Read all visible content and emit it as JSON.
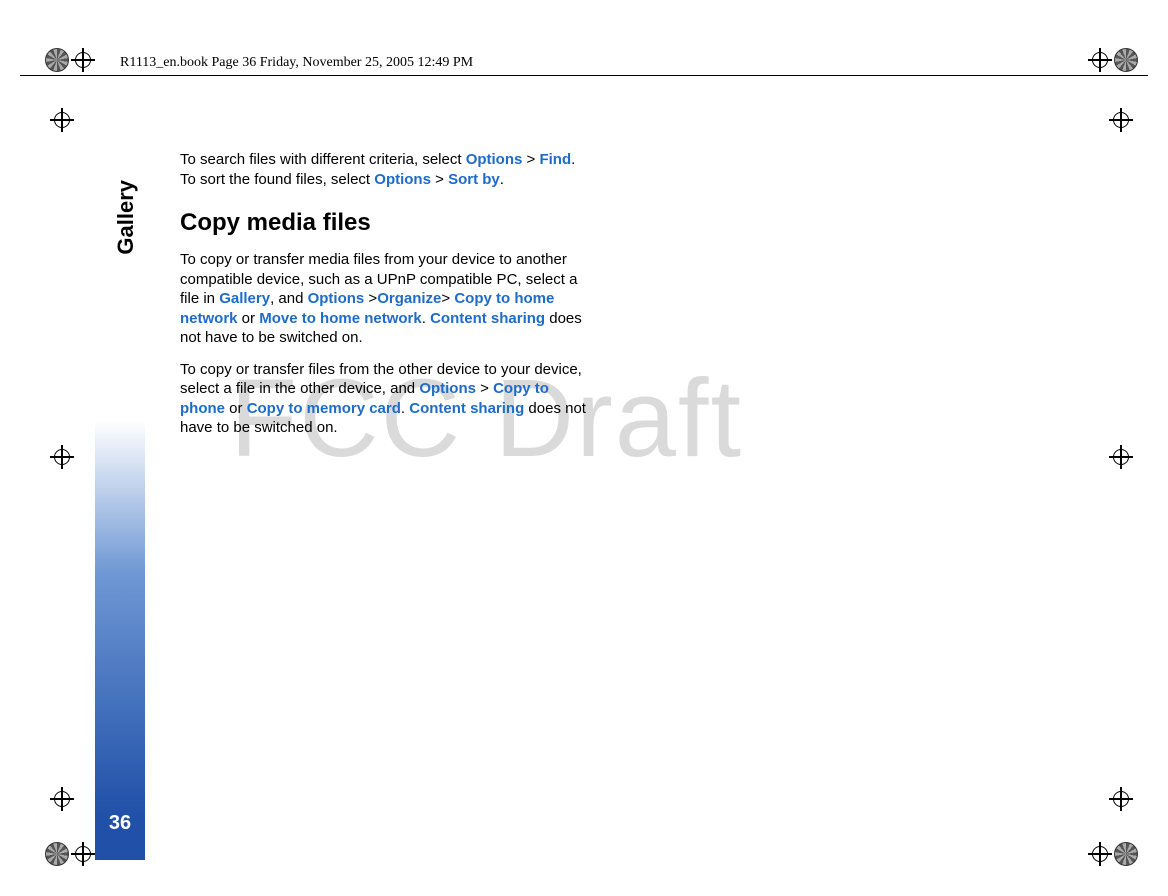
{
  "header": {
    "text": "R1113_en.book  Page 36  Friday, November 25, 2005  12:49 PM"
  },
  "sidebar": {
    "label": "Gallery",
    "page_number": "36"
  },
  "watermark": "FCC Draft",
  "body": {
    "para1_a": "To search files with different criteria, select ",
    "para1_opt1": "Options",
    "para1_b": " > ",
    "para1_opt2": "Find",
    "para1_c": ". To sort the found files, select ",
    "para1_opt3": "Options",
    "para1_d": " > ",
    "para1_opt4": "Sort by",
    "para1_e": ".",
    "heading": "Copy media files",
    "para2_a": "To copy or transfer media files from your device to another compatible device, such as a UPnP compatible PC, select a file in ",
    "para2_opt1": "Gallery",
    "para2_b": ", and ",
    "para2_opt2": "Options",
    "para2_c": " >",
    "para2_opt3": "Organize",
    "para2_d": "> ",
    "para2_opt4": "Copy to home network",
    "para2_e": " or ",
    "para2_opt5": "Move to home network",
    "para2_f": ". ",
    "para2_opt6": "Content sharing",
    "para2_g": " does not have to be switched on.",
    "para3_a": "To copy or transfer files from the other device to your device, select a file in the other device, and ",
    "para3_opt1": "Options",
    "para3_b": " > ",
    "para3_opt2": "Copy to phone",
    "para3_c": " or ",
    "para3_opt3": "Copy to memory card",
    "para3_d": ". ",
    "para3_opt4": "Content sharing",
    "para3_e": " does not have to be switched on."
  }
}
